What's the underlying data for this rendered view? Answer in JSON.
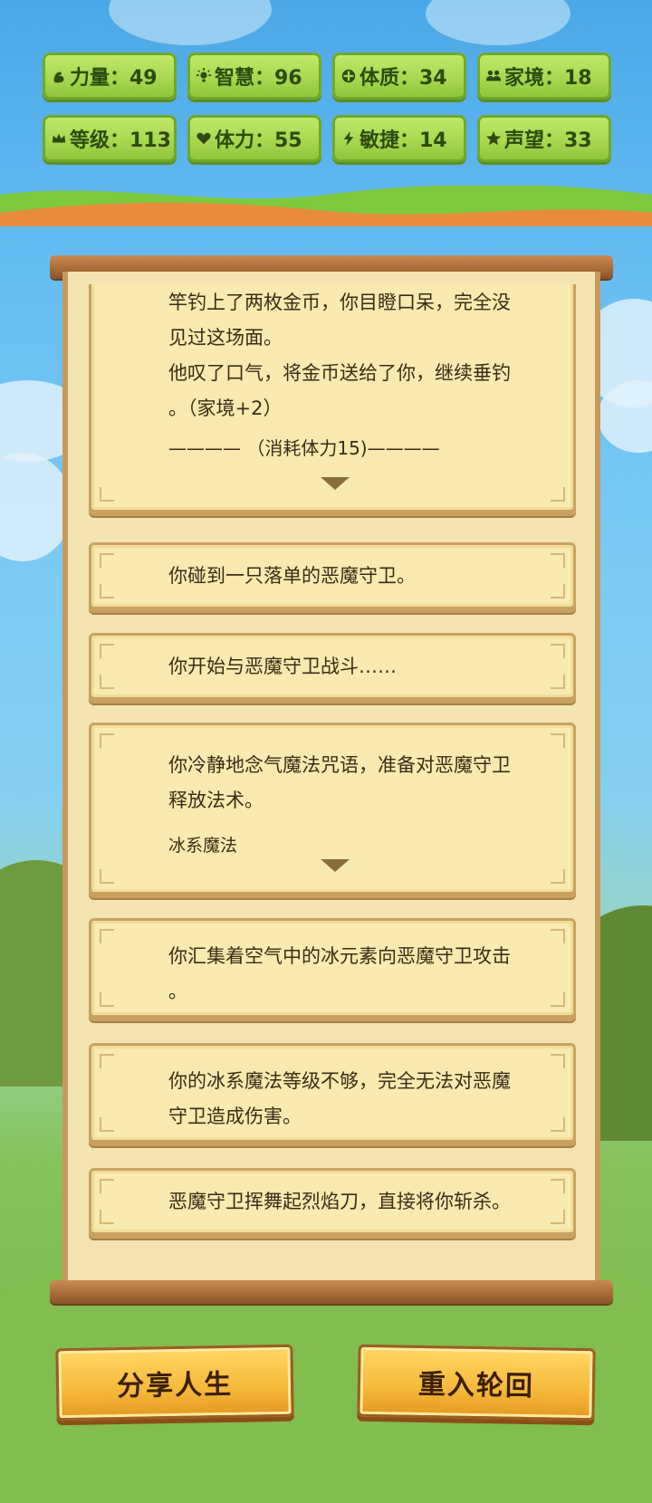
{
  "stats": [
    {
      "icon": "strength-icon",
      "label": "力量：49"
    },
    {
      "icon": "wisdom-icon",
      "label": "智慧：96"
    },
    {
      "icon": "constitution-icon",
      "label": "体质：34"
    },
    {
      "icon": "family-icon",
      "label": "家境：18"
    },
    {
      "icon": "crown-icon",
      "label": "等级：113"
    },
    {
      "icon": "heart-icon",
      "label": "体力：55"
    },
    {
      "icon": "lightning-icon",
      "label": "敏捷：14"
    },
    {
      "icon": "star-icon",
      "label": "声望：33"
    }
  ],
  "events": [
    {
      "text": "竿钓上了两枚金币，你目瞪口呆，完全没\n见过这场面。\n他叹了口气，将金币送给了你，继续垂钓\n。（家境+2）",
      "separator": "———— （消耗体力15)————"
    },
    {
      "text": "你碰到一只落单的恶魔守卫。"
    },
    {
      "text": "你开始与恶魔守卫战斗……"
    },
    {
      "text": "你冷静地念气魔法咒语，准备对恶魔守卫\n释放法术。",
      "choice": "冰系魔法"
    },
    {
      "text": "你汇集着空气中的冰元素向恶魔守卫攻击\n。"
    },
    {
      "text": "你的冰系魔法等级不够，完全无法对恶魔\n守卫造成伤害。"
    },
    {
      "text": "恶魔守卫挥舞起烈焰刀，直接将你斩杀。"
    }
  ],
  "buttons": {
    "share": "分享人生",
    "restart": "重入轮回"
  }
}
